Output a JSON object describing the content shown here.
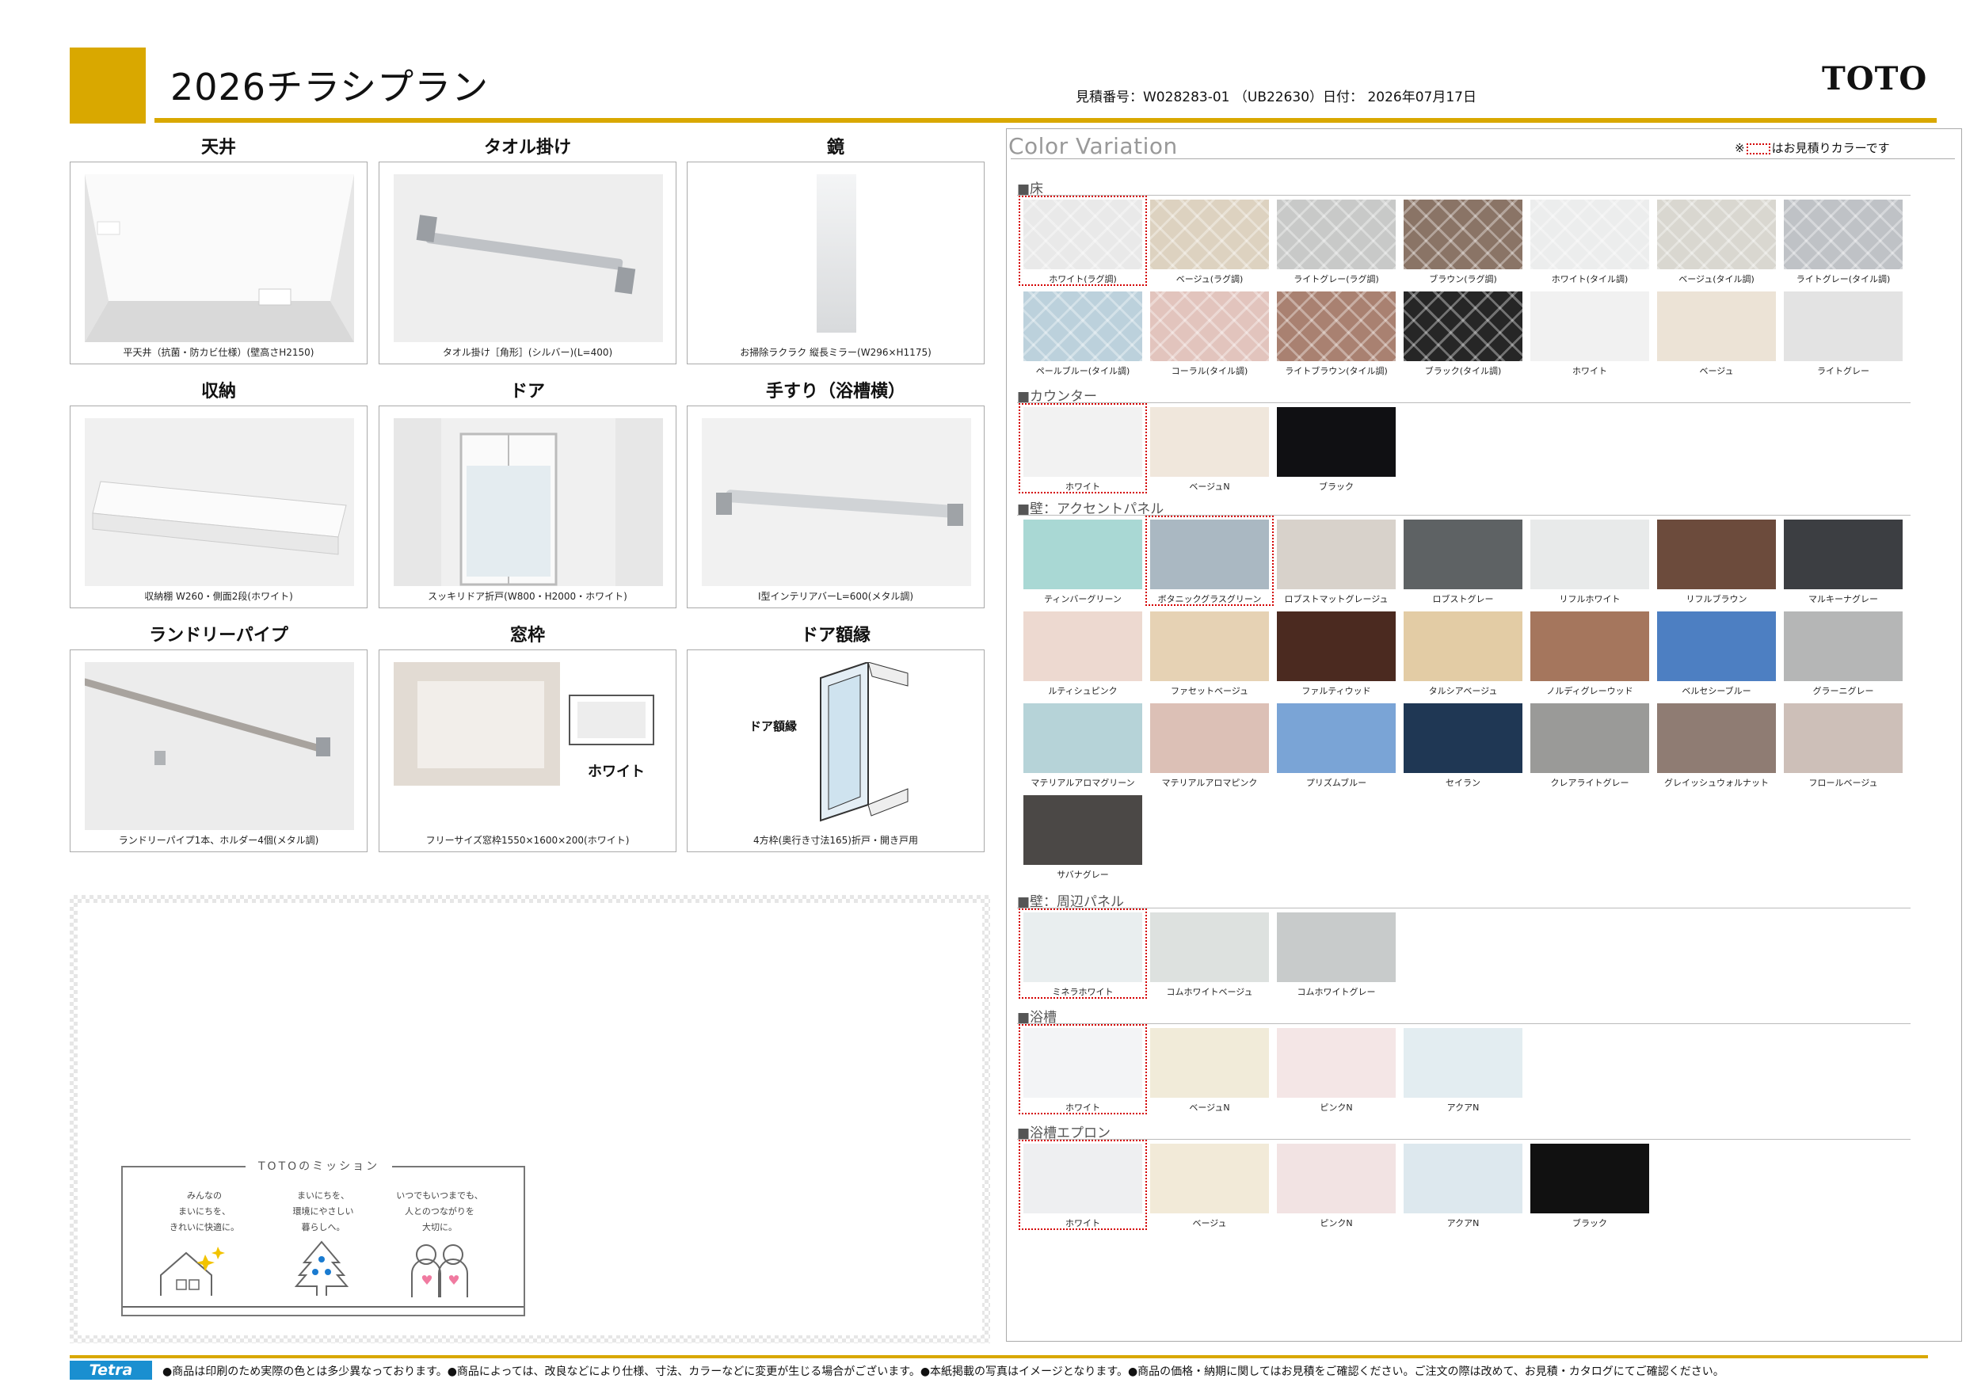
{
  "header": {
    "title": "2026チラシプラン",
    "estimate": "見積番号：W028283-01 （UB22630）日付： 2026年07月17日",
    "logo": "TOTO",
    "accent_color": "#d9a800"
  },
  "parts": [
    {
      "heading": "天井",
      "caption": "平天井（抗菌・防カビ仕様）(壁高さH2150)",
      "icon": "ceiling-image"
    },
    {
      "heading": "タオル掛け",
      "caption": "タオル掛け［角形］(シルバー)(L=400)",
      "icon": "towel-bar-image"
    },
    {
      "heading": "鏡",
      "caption": "お掃除ラクラク 縦長ミラー(W296×H1175)",
      "icon": "mirror-image"
    },
    {
      "heading": "収納",
      "caption": "収納棚 W260・側面2段(ホワイト)",
      "icon": "shelf-image"
    },
    {
      "heading": "ドア",
      "caption": "スッキリドア折戸(W800・H2000・ホワイト)",
      "icon": "door-image"
    },
    {
      "heading": "手すり（浴槽横）",
      "caption": "I型インテリアバーL=600(メタル調)",
      "icon": "handrail-image"
    },
    {
      "heading": "ランドリーパイプ",
      "caption": "ランドリーパイプ1本、ホルダー4個(メタル調)",
      "icon": "laundry-pipe-image"
    },
    {
      "heading": "窓枠",
      "caption": "フリーサイズ窓枠1550×1600×200(ホワイト)",
      "icon": "window-frame-image"
    },
    {
      "heading": "ドア額縁",
      "caption": "4方枠(奥行き寸法165)折戸・開き戸用",
      "icon": "door-frame-image"
    }
  ],
  "part_labels": {
    "window_white": "ホワイト",
    "door_frame_label": "ドア額縁"
  },
  "mission": {
    "title": "TOTOのミッション",
    "items": [
      {
        "lines": [
          "みんなの",
          "まいにちを、",
          "きれいに快適に。"
        ]
      },
      {
        "lines": [
          "まいにちを、",
          "環境にやさしい",
          "暮らしへ。"
        ]
      },
      {
        "lines": [
          "いつでもいつまでも、",
          "人とのつながりを",
          "大切に。"
        ]
      }
    ]
  },
  "color_variation": {
    "title": "Color Variation",
    "note_prefix": "※",
    "note_suffix": "はお見積りカラーです",
    "selected_color": "#d40000",
    "sections": [
      {
        "name": "■床",
        "swatches": [
          {
            "label": "ホワイト(ラグ調)",
            "color": "#e9e9e9",
            "selected": true
          },
          {
            "label": "ベージュ(ラグ調)",
            "color": "#ddd2c0"
          },
          {
            "label": "ライトグレー(ラグ調)",
            "color": "#c8c9c8"
          },
          {
            "label": "ブラウン(ラグ調)",
            "color": "#8a7466"
          },
          {
            "label": "ホワイト(タイル調)",
            "color": "#eceded"
          },
          {
            "label": "ベージュ(タイル調)",
            "color": "#d9d7d0"
          },
          {
            "label": "ライトグレー(タイル調)",
            "color": "#bfc2c6"
          },
          {
            "label": "ペールブルー(タイル調)",
            "color": "#bcd1dc"
          },
          {
            "label": "コーラル(タイル調)",
            "color": "#e2c4bd"
          },
          {
            "label": "ライトブラウン(タイル調)",
            "color": "#a98171"
          },
          {
            "label": "ブラック(タイル調)",
            "color": "#262626"
          },
          {
            "label": "ホワイト",
            "color": "#f1f1f1"
          },
          {
            "label": "ベージュ",
            "color": "#ece3d6"
          },
          {
            "label": "ライトグレー",
            "color": "#e3e3e3"
          }
        ]
      },
      {
        "name": "■カウンター",
        "swatches": [
          {
            "label": "ホワイト",
            "color": "#f2f2f2",
            "selected": true
          },
          {
            "label": "ベージュN",
            "color": "#f0e7dc"
          },
          {
            "label": "ブラック",
            "color": "#101013"
          }
        ]
      },
      {
        "name": "■壁：アクセントパネル",
        "swatches": [
          {
            "label": "ティンバーグリーン",
            "color": "#a9d8d4"
          },
          {
            "label": "ボタニックグラスグリーン",
            "color": "#aab8c2",
            "selected": true
          },
          {
            "label": "ロブストマットグレージュ",
            "color": "#d8d2cb"
          },
          {
            "label": "ロブストグレー",
            "color": "#5e6264"
          },
          {
            "label": "リフルホワイト",
            "color": "#e8eaea"
          },
          {
            "label": "リフルブラウン",
            "color": "#6c4b3c"
          },
          {
            "label": "マルキーナグレー",
            "color": "#3c3e42"
          },
          {
            "label": "ルティシュピンク",
            "color": "#edd9d0"
          },
          {
            "label": "ファセットベージュ",
            "color": "#e6d2b4"
          },
          {
            "label": "ファルティウッド",
            "color": "#4b2a20"
          },
          {
            "label": "タルシアベージュ",
            "color": "#e3cca5"
          },
          {
            "label": "ノルディグレーウッド",
            "color": "#a5765d"
          },
          {
            "label": "ベルセシーブルー",
            "color": "#4d7fc2"
          },
          {
            "label": "グラーニグレー",
            "color": "#b5b6b6"
          },
          {
            "label": "マテリアルアロマグリーン",
            "color": "#b6d3d8"
          },
          {
            "label": "マテリアルアロマピンク",
            "color": "#dcc0b6"
          },
          {
            "label": "プリズムブルー",
            "color": "#7aa4d6"
          },
          {
            "label": "セイラン",
            "color": "#1f3754"
          },
          {
            "label": "クレアライトグレー",
            "color": "#9a9a98"
          },
          {
            "label": "グレイッシュウォルナット",
            "color": "#8f7c73"
          },
          {
            "label": "フロールベージュ",
            "color": "#cdbfb8"
          },
          {
            "label": "サバナグレー",
            "color": "#4b4846"
          }
        ]
      },
      {
        "name": "■壁：周辺パネル",
        "swatches": [
          {
            "label": "ミネラホワイト",
            "color": "#e9eeef",
            "selected": true
          },
          {
            "label": "コムホワイトベージュ",
            "color": "#dde1df"
          },
          {
            "label": "コムホワイトグレー",
            "color": "#c8cbcb"
          }
        ]
      },
      {
        "name": "■浴槽",
        "swatches": [
          {
            "label": "ホワイト",
            "color": "#f3f4f6",
            "selected": true
          },
          {
            "label": "ベージュN",
            "color": "#f1ebd9"
          },
          {
            "label": "ピンクN",
            "color": "#f4e6e6"
          },
          {
            "label": "アクアN",
            "color": "#e3edf1"
          }
        ]
      },
      {
        "name": "■浴槽エプロン",
        "swatches": [
          {
            "label": "ホワイト",
            "color": "#eeeff1",
            "selected": true
          },
          {
            "label": "ベージュ",
            "color": "#f2ead8"
          },
          {
            "label": "ピンクN",
            "color": "#f2e3e3"
          },
          {
            "label": "アクアN",
            "color": "#dde8ee"
          },
          {
            "label": "ブラック",
            "color": "#111111"
          }
        ]
      }
    ]
  },
  "footer": {
    "logo": "Tetra",
    "text": "●商品は印刷のため実際の色とは多少異なっております。●商品によっては、改良などにより仕様、寸法、カラーなどに変更が生じる場合がございます。●本紙掲載の写真はイメージとなります。●商品の価格・納期に関してはお見積をご確認ください。ご注文の際は改めて、お見積・カタログにてご確認ください。"
  }
}
